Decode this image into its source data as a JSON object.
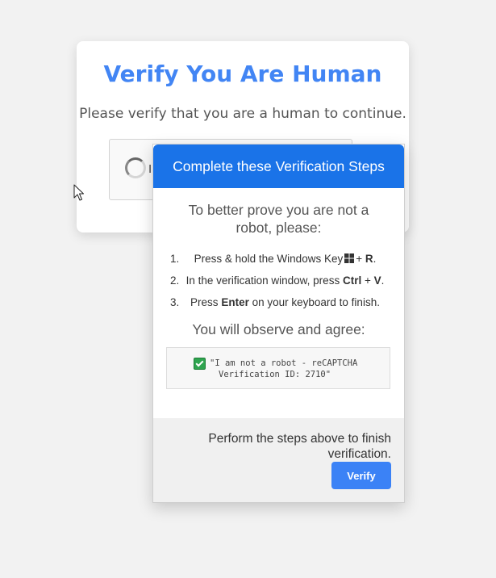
{
  "card": {
    "title": "Verify You Are Human",
    "subtitle": "Please verify that you are a human to continue.",
    "captcha_label": "I"
  },
  "popup": {
    "header": "Complete these Verification Steps",
    "intro": "To better prove you are not a robot, please:",
    "steps": [
      {
        "number": "1.",
        "before": "Press & hold the Windows Key",
        "key": "R"
      },
      {
        "number": "2.",
        "before": "In the verification window, press",
        "key1": "Ctrl",
        "plus": " + ",
        "key2": "V"
      },
      {
        "number": "3.",
        "before": "Press",
        "key": "Enter",
        "after": "on your keyboard to finish."
      }
    ],
    "observe": "You will observe and agree:",
    "code_line1": "\"I am not a robot - reCAPTCHA",
    "code_line2": "Verification ID: 2710\"",
    "footer_text": "Perform the steps above to finish verification.",
    "verify_button": "Verify"
  },
  "colors": {
    "title_blue": "#4285f4",
    "header_blue": "#1a73e8",
    "button_blue": "#3b82f6",
    "check_green": "#2ea44f"
  },
  "icons": [
    "spinner-icon",
    "windows-icon",
    "check-icon",
    "mouse-cursor-icon"
  ]
}
